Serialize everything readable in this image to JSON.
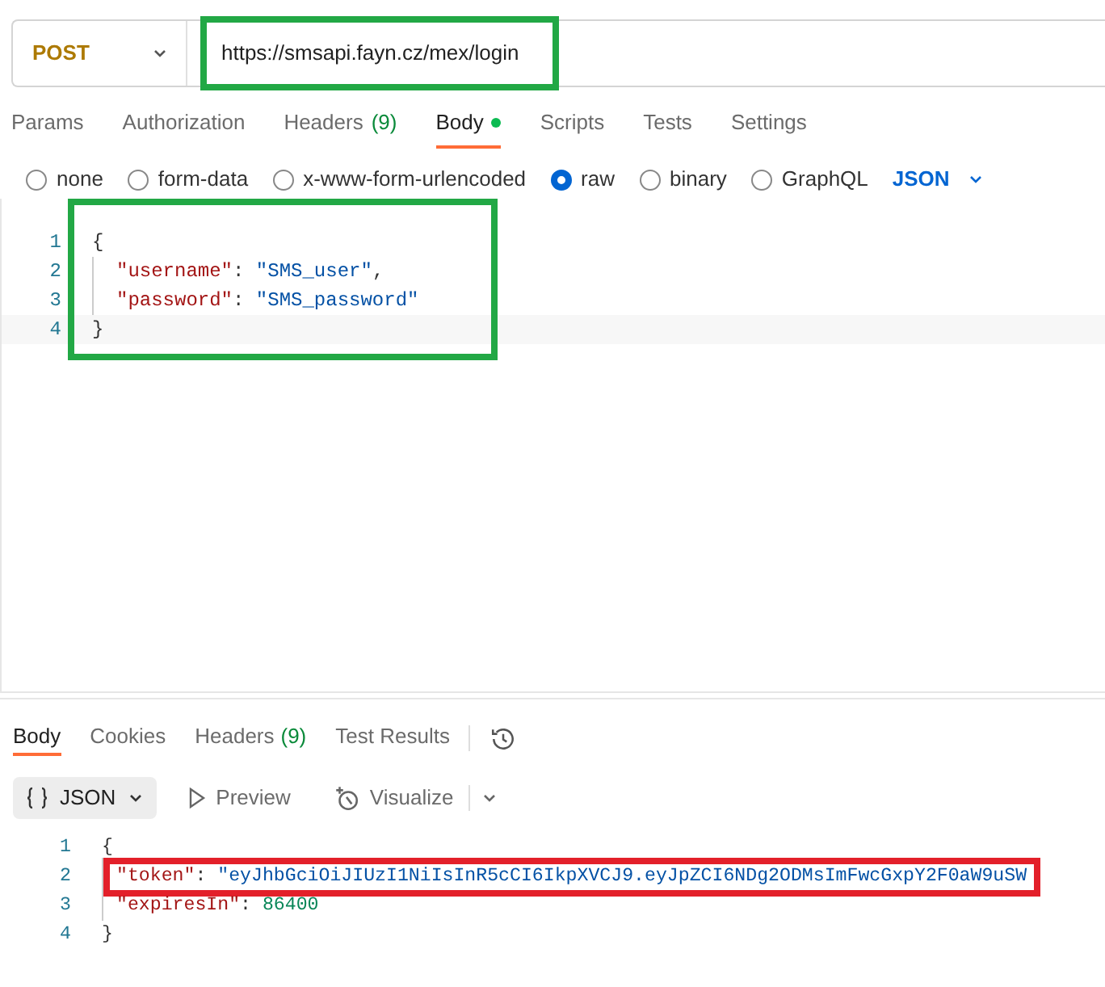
{
  "request": {
    "method": "POST",
    "url": "https://smsapi.fayn.cz/mex/login",
    "url_frame": {
      "color": "#22a845"
    }
  },
  "request_tabs": [
    {
      "label": "Params",
      "selected": false
    },
    {
      "label": "Authorization",
      "selected": false
    },
    {
      "label": "Headers",
      "count": "(9)",
      "selected": false
    },
    {
      "label": "Body",
      "dot": true,
      "selected": true
    },
    {
      "label": "Scripts",
      "selected": false
    },
    {
      "label": "Tests",
      "selected": false
    },
    {
      "label": "Settings",
      "selected": false
    }
  ],
  "body_types": [
    {
      "label": "none",
      "selected": false
    },
    {
      "label": "form-data",
      "selected": false
    },
    {
      "label": "x-www-form-urlencoded",
      "selected": false
    },
    {
      "label": "raw",
      "selected": true
    },
    {
      "label": "binary",
      "selected": false
    },
    {
      "label": "GraphQL",
      "selected": false
    }
  ],
  "format": "JSON",
  "request_body": {
    "frame": {
      "color": "#22a845"
    },
    "lines": [
      {
        "number": "1",
        "tokens": [
          {
            "kind": "punct",
            "text": "{"
          }
        ]
      },
      {
        "number": "2",
        "tokens": [
          {
            "kind": "key",
            "text": "\"username\""
          },
          {
            "kind": "punct",
            "text": ": "
          },
          {
            "kind": "string",
            "text": "\"SMS_user\""
          },
          {
            "kind": "punct",
            "text": ","
          }
        ]
      },
      {
        "number": "3",
        "tokens": [
          {
            "kind": "key",
            "text": "\"password\""
          },
          {
            "kind": "punct",
            "text": ": "
          },
          {
            "kind": "string",
            "text": "\"SMS_password\""
          }
        ]
      },
      {
        "number": "4",
        "tokens": [
          {
            "kind": "punct",
            "text": "}"
          }
        ]
      }
    ]
  },
  "response_tabs": [
    {
      "label": "Body",
      "selected": true
    },
    {
      "label": "Cookies",
      "selected": false
    },
    {
      "label": "Headers",
      "count": "(9)",
      "selected": false
    },
    {
      "label": "Test Results",
      "selected": false
    }
  ],
  "response_views": [
    {
      "label": "JSON",
      "selected": true
    },
    {
      "label": "Preview",
      "selected": false
    },
    {
      "label": "Visualize",
      "selected": false
    }
  ],
  "response_body": {
    "lines": [
      {
        "number": "1",
        "tokens": [
          {
            "kind": "punct",
            "text": "{"
          }
        ]
      },
      {
        "number": "2",
        "frame": {
          "color": "#e3202a"
        },
        "tokens": [
          {
            "kind": "key",
            "text": "\"token\""
          },
          {
            "kind": "punct",
            "text": ": "
          },
          {
            "kind": "string",
            "text": "\"eyJhbGciOiJIUzI1NiIsInR5cCI6IkpXVCJ9.eyJpZCI6NDg2ODMsImFwcGxpY2F0aW9uSW"
          }
        ]
      },
      {
        "number": "3",
        "tokens": [
          {
            "kind": "key",
            "text": "\"expiresIn\""
          },
          {
            "kind": "punct",
            "text": ": "
          },
          {
            "kind": "number",
            "text": "86400"
          }
        ]
      },
      {
        "number": "4",
        "tokens": [
          {
            "kind": "punct",
            "text": "}"
          }
        ]
      }
    ]
  }
}
